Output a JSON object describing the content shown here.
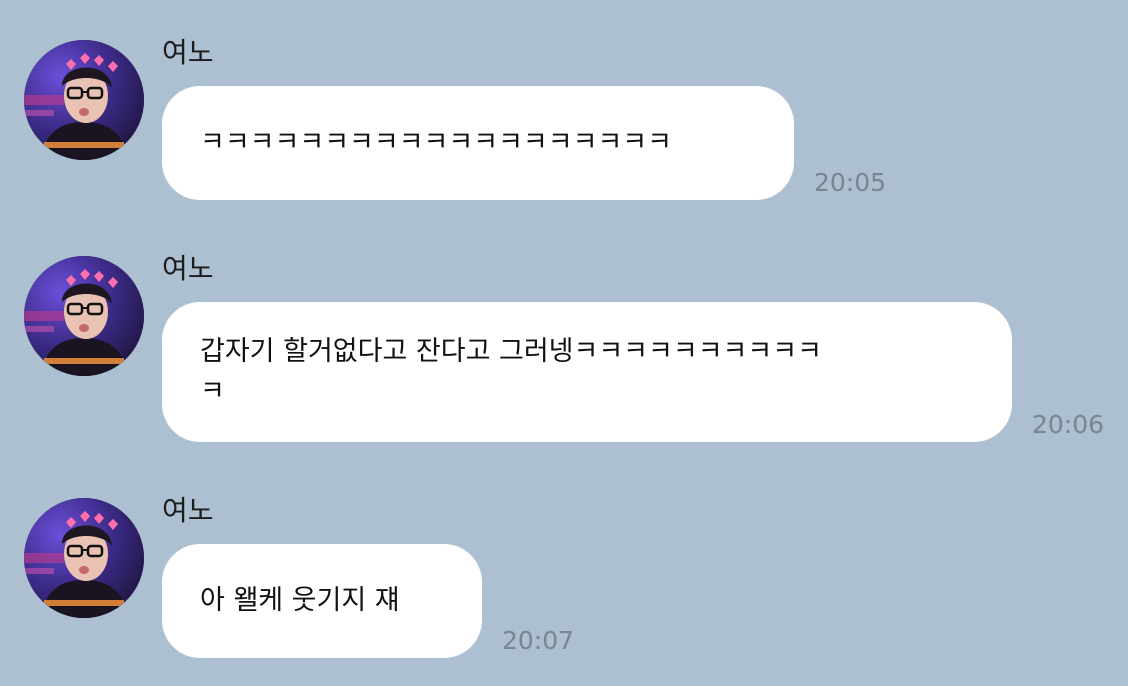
{
  "chat": {
    "messages": [
      {
        "sender": "여노",
        "text": "ㅋㅋㅋㅋㅋㅋㅋㅋㅋㅋㅋㅋㅋㅋㅋㅋㅋㅋㅋ",
        "time": "20:05",
        "avatar_icon": "profile-photo-avatar"
      },
      {
        "sender": "여노",
        "text": "갑자기 할거없다고 잔다고 그러넹ㅋㅋㅋㅋㅋㅋㅋㅋㅋㅋ\nㅋ",
        "time": "20:06",
        "avatar_icon": "profile-photo-avatar"
      },
      {
        "sender": "여노",
        "text": "아 왤케 웃기지 쟤",
        "time": "20:07",
        "avatar_icon": "profile-photo-avatar"
      }
    ]
  },
  "colors": {
    "background": "#acc0d1",
    "bubble": "#ffffff",
    "timestamp": "#7b8590",
    "avatar_glow": "#ff6fae"
  }
}
